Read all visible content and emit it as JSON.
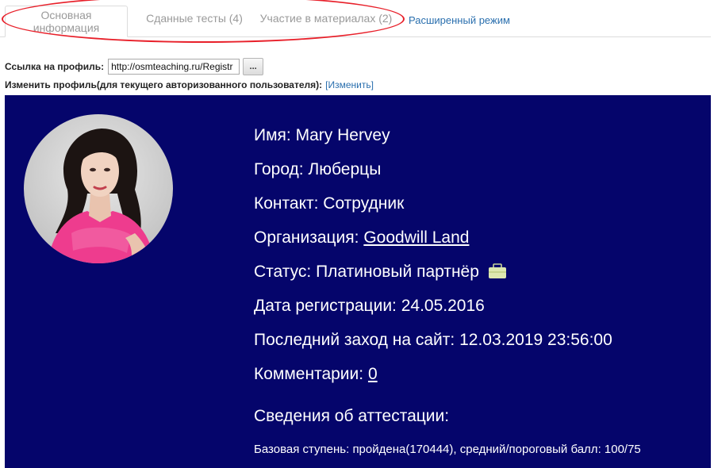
{
  "tabs": {
    "main_info": "Основная информация",
    "tests": "Сданные тесты (4)",
    "materials": "Участие в материалах (2)",
    "advanced": "Расширенный режим"
  },
  "profile_link": {
    "label": "Ссылка на профиль:",
    "value": "http://osmteaching.ru/Registr",
    "button": "..."
  },
  "edit_profile": {
    "label": "Изменить профиль(для текущего авторизованного пользователя):",
    "link": "[Изменить]"
  },
  "profile": {
    "name_label": "Имя:",
    "name": "Mary Hervey",
    "city_label": "Город:",
    "city": "Люберцы",
    "contact_label": "Контакт:",
    "contact": "Сотрудник",
    "org_label": "Организация:",
    "org": "Goodwill Land",
    "status_label": "Статус:",
    "status": "Платиновый партнёр",
    "status_icon": "briefcase-icon",
    "reg_label": "Дата регистрации:",
    "reg_date": "24.05.2016",
    "last_label": "Последний заход на сайт:",
    "last_visit": "12.03.2019 23:56:00",
    "comments_label": "Комментарии:",
    "comments": "0",
    "attest_title": "Сведения об аттестации:",
    "attest_line": "Базовая ступень: пройдена(170444), средний/пороговый балл: 100/75"
  },
  "colors": {
    "panel_bg": "#05056b",
    "link": "#2a6fae",
    "highlight": "#e8202a"
  }
}
